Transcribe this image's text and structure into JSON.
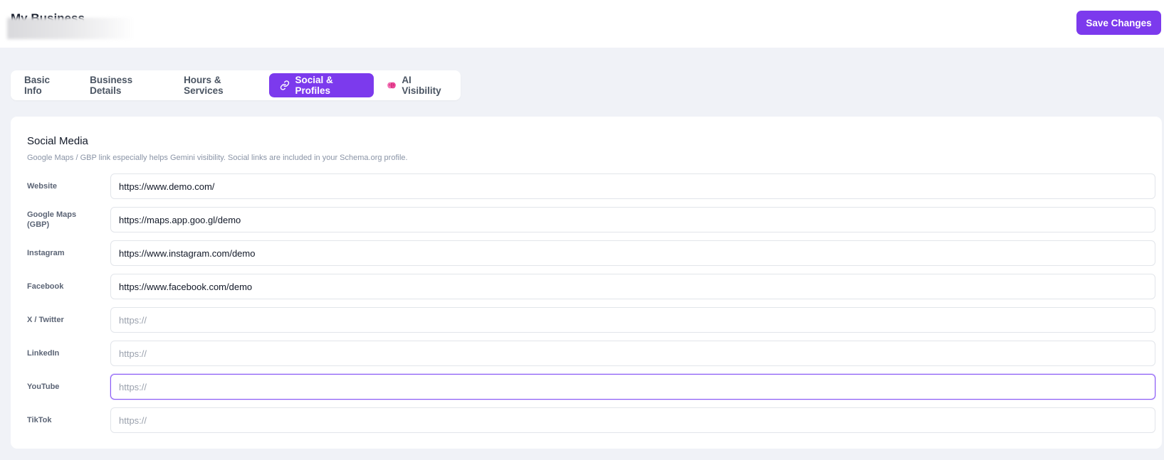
{
  "header": {
    "title": "My Business",
    "save_label": "Save Changes"
  },
  "tabs": [
    {
      "label": "Basic Info",
      "icon": "",
      "active": false
    },
    {
      "label": "Business Details",
      "icon": "",
      "active": false
    },
    {
      "label": "Hours & Services",
      "icon": "",
      "active": false
    },
    {
      "label": "Social & Profiles",
      "icon": "link-icon",
      "active": true
    },
    {
      "label": "AI Visibility",
      "icon": "brain-icon",
      "active": false
    }
  ],
  "section": {
    "title": "Social Media",
    "subtitle": "Google Maps / GBP link especially helps Gemini visibility. Social links are included in your Schema.org profile."
  },
  "fields": [
    {
      "label": "Website",
      "value": "https://www.demo.com/",
      "placeholder": "https://"
    },
    {
      "label": "Google Maps (GBP)",
      "value": "https://maps.app.goo.gl/demo",
      "placeholder": "https://"
    },
    {
      "label": "Instagram",
      "value": "https://www.instagram.com/demo",
      "placeholder": "https://"
    },
    {
      "label": "Facebook",
      "value": "https://www.facebook.com/demo",
      "placeholder": "https://"
    },
    {
      "label": "X / Twitter",
      "value": "",
      "placeholder": "https://"
    },
    {
      "label": "LinkedIn",
      "value": "",
      "placeholder": "https://"
    },
    {
      "label": "YouTube",
      "value": "",
      "placeholder": "https://",
      "focused": true
    },
    {
      "label": "TikTok",
      "value": "",
      "placeholder": "https://"
    }
  ],
  "colors": {
    "accent": "#7c3aed",
    "background": "#f0f2f7",
    "focus_border": "#8b5cf6"
  }
}
